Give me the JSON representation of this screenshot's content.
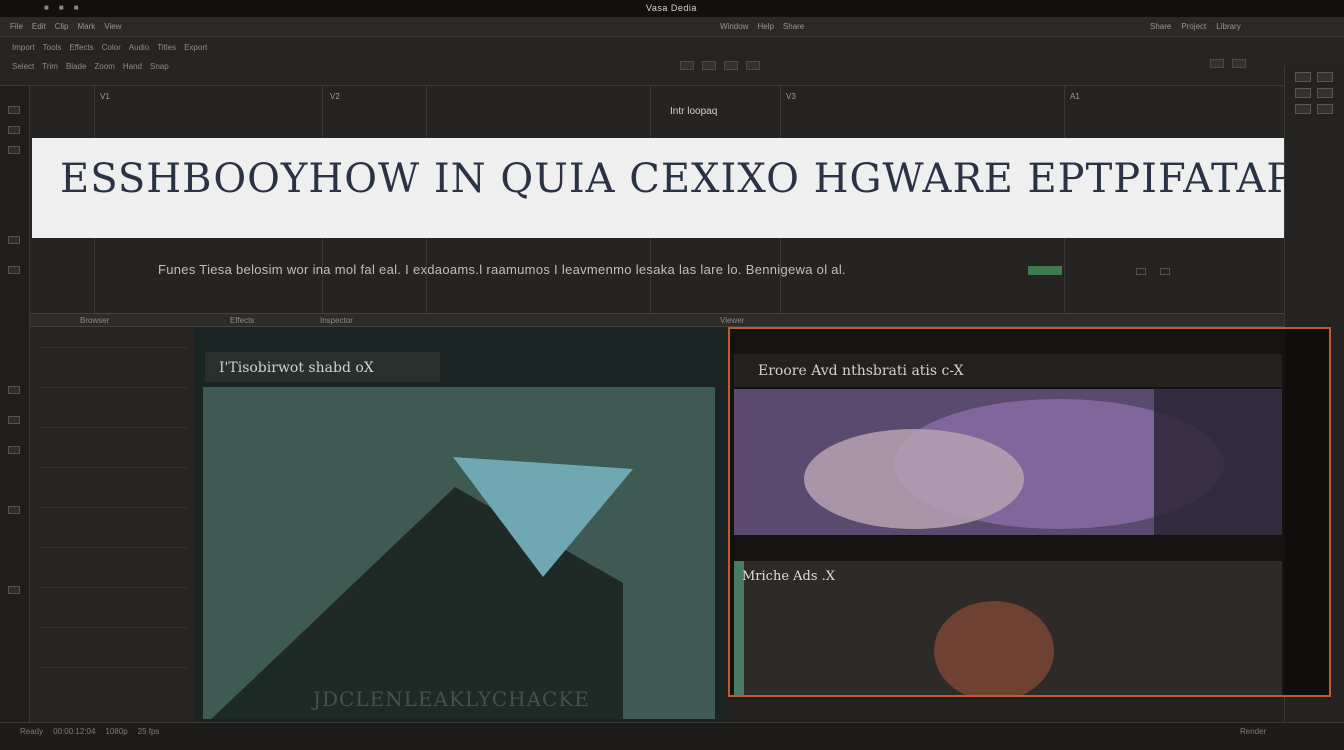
{
  "window": {
    "title": "Vasa  Dedia"
  },
  "menu_left": [
    "File",
    "Edit",
    "Clip",
    "Mark",
    "View"
  ],
  "menu_mid": [
    "Window",
    "Help",
    "Share"
  ],
  "menu_right": [
    "Share",
    "Project",
    "Library"
  ],
  "toolbar_row1": [
    "Import",
    "Tools",
    "Effects",
    "Color",
    "Audio",
    "Titles",
    "Export"
  ],
  "toolbar_row2": [
    "Select",
    "Trim",
    "Blade",
    "Zoom",
    "Hand",
    "Snap"
  ],
  "timeline": {
    "track_labels": [
      "V1",
      "V2",
      "V3",
      "A1"
    ],
    "clip_label": "Intr loopaq",
    "overlay_title": "ESSHBOOYHOW IN QUIA CEXIXO HGWARE EPTPIFATAPIS",
    "subtitle": "Funes Tiesa belosim  wor ina mol fal eal.  I exdaoams.l raamumos  I  leavmenmo lesaka las lare lo.  Bennigewa ol al."
  },
  "midbar": {
    "labels": [
      "Browser",
      "Effects",
      "Inspector",
      "Viewer"
    ]
  },
  "viewer_a": {
    "tab_title": "I'Tisobirwot shabd oX",
    "caption": "JDCLENLEAKLYCHACKE"
  },
  "viewer_b": {
    "tab_title": "Eroore Avd nthsbrati atis c-X",
    "second_label": "Mriche Ads .X"
  },
  "statusbar": {
    "items": [
      "Ready",
      "00:00:12:04",
      "1080p",
      "25 fps",
      "Render"
    ]
  },
  "colors": {
    "accent": "#c05a32",
    "green_meter": "#3f7a4e",
    "overlay_bg": "#efefef",
    "overlay_text": "#2b3244"
  }
}
